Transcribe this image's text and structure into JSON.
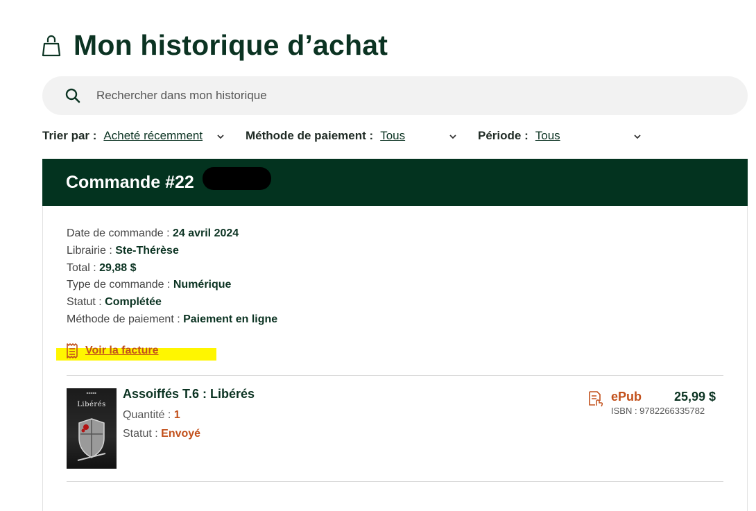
{
  "page": {
    "title": "Mon historique d’achat",
    "icon": "shopping-bag-icon"
  },
  "search": {
    "placeholder": "Rechercher dans mon historique",
    "value": "",
    "icon": "search-icon"
  },
  "filters": {
    "sort": {
      "label": "Trier par :",
      "value": "Acheté récemment"
    },
    "payment": {
      "label": "Méthode de paiement :",
      "value": "Tous"
    },
    "period": {
      "label": "Période :",
      "value": "Tous"
    }
  },
  "order": {
    "title": "Commande #22",
    "details": [
      {
        "label": "Date de commande : ",
        "value": "24 avril 2024"
      },
      {
        "label": "Librairie : ",
        "value": "Ste-Thérèse"
      },
      {
        "label": "Total : ",
        "value": "29,88 $"
      },
      {
        "label": "Type de commande : ",
        "value": "Numérique"
      },
      {
        "label": "Statut : ",
        "value": "Complétée"
      },
      {
        "label": "Méthode de paiement : ",
        "value": "Paiement en ligne"
      }
    ],
    "invoice_link": "Voir la facture",
    "items": [
      {
        "cover_title": "Libérés",
        "title": "Assoiffés T.6 : Libérés",
        "quantity_label": "Quantité : ",
        "quantity": "1",
        "status_label": "Statut : ",
        "status": "Envoyé",
        "format": "ePub",
        "price": "25,99 $",
        "isbn": "ISBN : 9782266335782"
      }
    ]
  },
  "colors": {
    "brand_dark": "#03331f",
    "accent": "#c2501b",
    "highlight": "#fff600"
  }
}
